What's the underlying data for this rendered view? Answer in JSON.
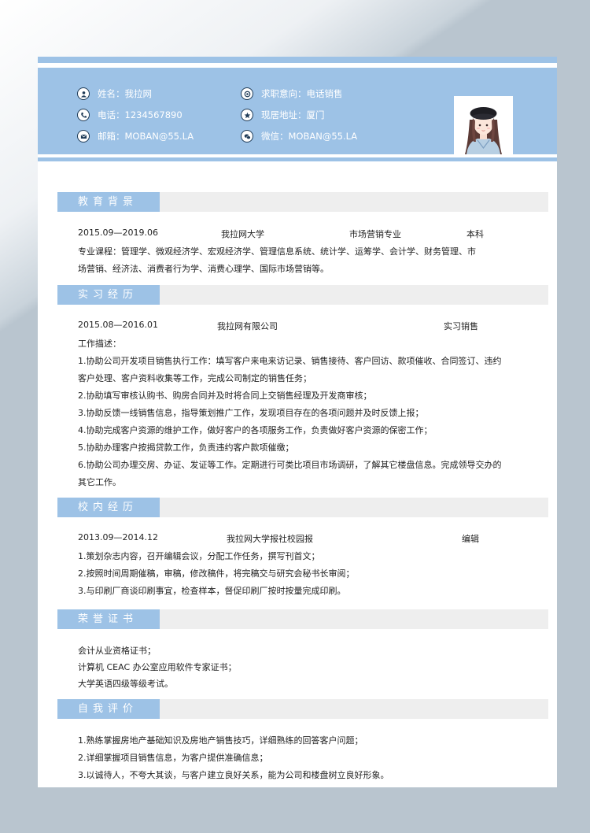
{
  "header": {
    "name": "姓名：我拉网",
    "intent": "求职意向：电话销售",
    "phone": "电话：1234567890",
    "address": "现居地址：厦门",
    "email": "邮箱：MOBAN@55.LA",
    "wechat": "微信：MOBAN@55.LA"
  },
  "education": {
    "title": "教育背景",
    "period": "2015.09—2019.06",
    "school": "我拉网大学",
    "major": "市场营销专业",
    "degree": "本科",
    "courses_1": "专业课程：管理学、微观经济学、宏观经济学、管理信息系统、统计学、运筹学、会计学、财务管理、市",
    "courses_2": "场营销、经济法、消费者行为学、消费心理学、国际市场营销等。"
  },
  "internship": {
    "title": "实习经历",
    "period": "2015.08—2016.01",
    "company": "我拉网有限公司",
    "position": "实习销售",
    "desc_label": "工作描述：",
    "lines": [
      "1.协助公司开发项目销售执行工作：填写客户来电来访记录、销售接待、客户回访、款项催收、合同签订、违约",
      "客户处理、客户资料收集等工作，完成公司制定的销售任务；",
      "2.协助填写审核认购书、购房合同并及时将合同上交销售经理及开发商审核；",
      "3.协助反馈一线销售信息，指导策划推广工作，发现项目存在的各项问题并及时反馈上报；",
      "4.协助完成客户资源的维护工作，做好客户的各项服务工作，负责做好客户资源的保密工作；",
      "5.协助办理客户按揭贷款工作，负责违约客户款项催缴；",
      "6.协助公司办理交房、办证、发证等工作。定期进行可类比项目市场调研，了解其它楼盘信息。完成领导交办的",
      "其它工作。"
    ]
  },
  "campus": {
    "title": "校内经历",
    "period": "2013.09—2014.12",
    "org": "我拉网大学报社校园报",
    "role": "编辑",
    "lines": [
      "1.策划杂志内容，召开编辑会议，分配工作任务，撰写刊首文；",
      "2.按照时间周期催稿，审稿，修改稿件，将完稿交与研究会秘书长审阅；",
      "3.与印刷厂商谈印刷事宜，检查样本，督促印刷厂按时按量完成印刷。"
    ]
  },
  "honors": {
    "title": "荣誉证书",
    "lines": [
      "会计从业资格证书；",
      "计算机 CEAC 办公室应用软件专家证书；",
      "大学英语四级等级考试。"
    ]
  },
  "self_eval": {
    "title": "自我评价",
    "lines": [
      "1.熟练掌握房地产基础知识及房地产销售技巧，详细熟练的回答客户问题；",
      "2.详细掌握项目销售信息，为客户提供准确信息；",
      "3.以诚待人，不夸大其谈，与客户建立良好关系，能为公司和楼盘树立良好形象。"
    ]
  },
  "colors": {
    "accent": "#9dc2e6",
    "icon": "#1f3b57",
    "bar": "#eeeeee"
  },
  "icons": [
    "user-icon",
    "phone-icon",
    "mail-icon",
    "target-icon",
    "star-icon",
    "wechat-icon"
  ]
}
